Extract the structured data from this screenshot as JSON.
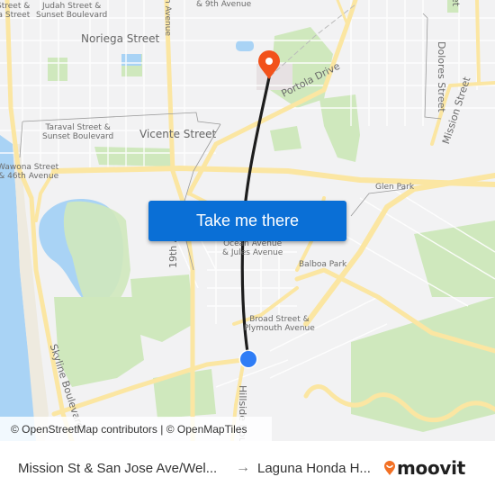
{
  "map": {
    "colors": {
      "background": "#f2f2f3",
      "water": "#a9d3f5",
      "park": "#cfe8bd",
      "major_road": "#fbe6a2",
      "minor_road": "#ffffff",
      "route_line": "#1d1d1d",
      "origin_marker": "#2f7df6",
      "destination_marker": "#f2521b",
      "button": "#0a6fd6"
    },
    "labels": {
      "street_and_a": "Street &",
      "a_street": "a Street",
      "judah": "Judah Street &",
      "judah2": "Sunset Boulevard",
      "ninth_ave": "& 9th Avenue",
      "noriega": "Noriega Street",
      "avenue_top": "h Avenue",
      "taraval": "Taraval Street &",
      "taraval2": "Sunset Boulevard",
      "vicente": "Vicente Street",
      "wawona": "Wawona Street",
      "wawona2": "& 46th Avenue",
      "portola": "Portola Drive",
      "dolores": "Dolores Street",
      "mission": "Mission Street",
      "street_top_right": "et",
      "glen_park": "Glen Park",
      "nineteenth": "19th A",
      "ocean": "Ocean Avenue",
      "ocean2": "& Jules Avenue",
      "balboa": "Balboa Park",
      "broad": "Broad Street &",
      "broad2": "Plymouth Avenue",
      "skyline": "Skyline Boulevard",
      "hillside": "Hillside Bou"
    },
    "cta_button": "Take me there",
    "attribution": "© OpenStreetMap contributors | © OpenMapTiles"
  },
  "footer": {
    "origin": "Mission St & San Jose Ave/Wel...",
    "arrow": "→",
    "destination": "Laguna Honda H...",
    "brand": "moovit"
  }
}
